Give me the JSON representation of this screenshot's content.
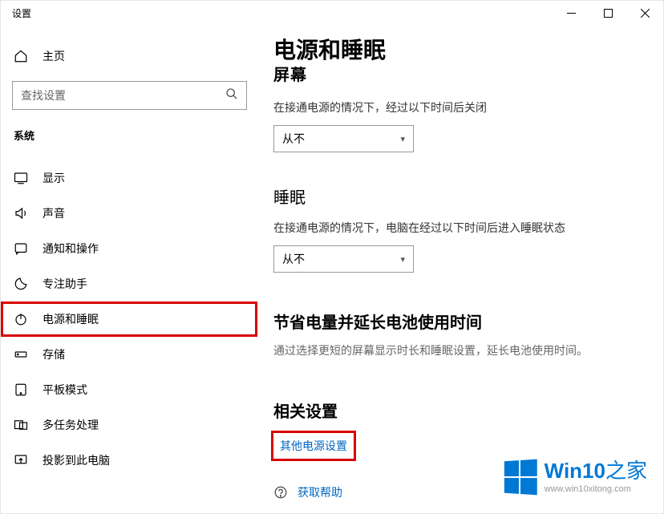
{
  "window": {
    "title": "设置"
  },
  "sidebar": {
    "home": "主页",
    "search_placeholder": "查找设置",
    "section": "系统",
    "items": [
      {
        "icon": "display",
        "label": "显示"
      },
      {
        "icon": "sound",
        "label": "声音"
      },
      {
        "icon": "notify",
        "label": "通知和操作"
      },
      {
        "icon": "focus",
        "label": "专注助手"
      },
      {
        "icon": "power",
        "label": "电源和睡眠",
        "highlight": true
      },
      {
        "icon": "storage",
        "label": "存储"
      },
      {
        "icon": "tablet",
        "label": "平板模式"
      },
      {
        "icon": "multi",
        "label": "多任务处理"
      },
      {
        "icon": "project",
        "label": "投影到此电脑"
      }
    ]
  },
  "main": {
    "title": "电源和睡眠",
    "screen_section": "屏幕",
    "power_screen_desc": "在接通电源的情况下，经过以下时间后关闭",
    "combo1": "从不",
    "sleep_section": "睡眠",
    "sleep_desc": "在接通电源的情况下，电脑在经过以下时间后进入睡眠状态",
    "combo2": "从不",
    "battery_title": "节省电量并延长电池使用时间",
    "battery_desc": "通过选择更短的屏幕显示时长和睡眠设置，延长电池使用时间。",
    "related_title": "相关设置",
    "related_link": "其他电源设置",
    "help_link": "获取帮助"
  },
  "watermark": {
    "brand_a": "Win10",
    "brand_b": "之家",
    "url": "www.win10xitong.com"
  }
}
